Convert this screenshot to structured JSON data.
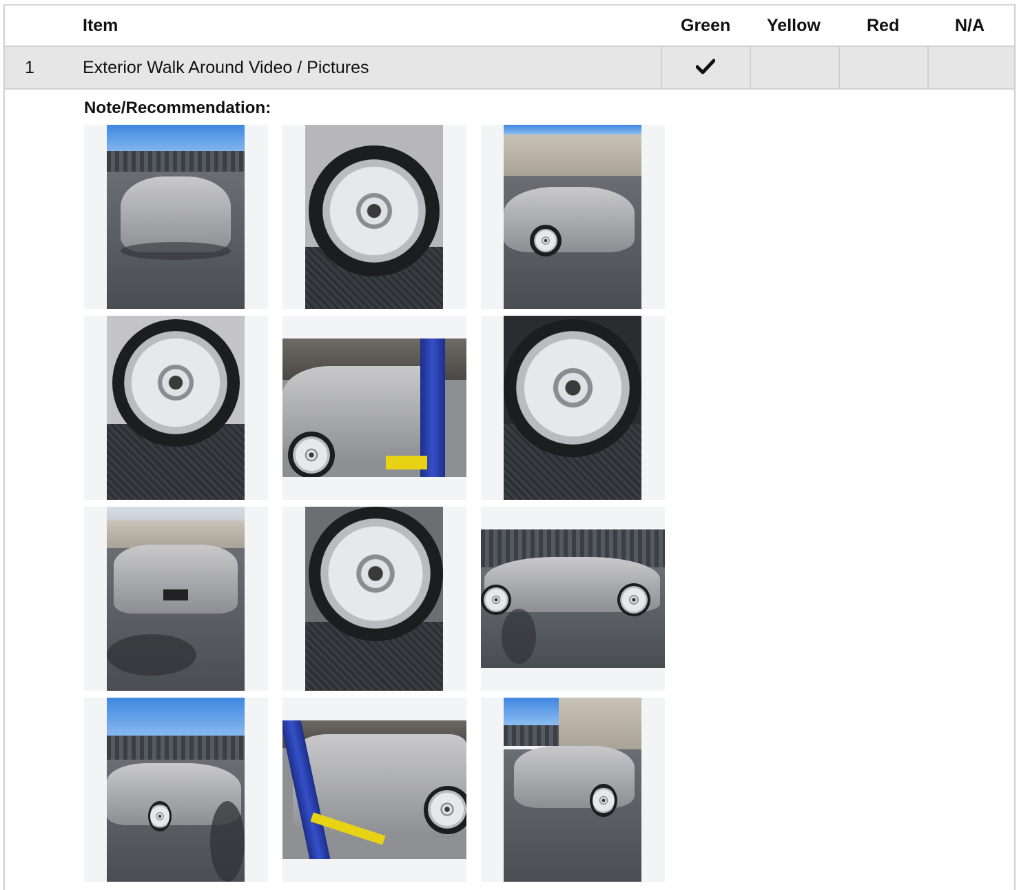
{
  "table": {
    "headers": {
      "item": "Item",
      "green": "Green",
      "yellow": "Yellow",
      "red": "Red",
      "na": "N/A"
    },
    "rows": [
      {
        "number": "1",
        "item": "Exterior Walk Around Video / Pictures",
        "status": "green",
        "check_icon": "checkmark-icon"
      }
    ]
  },
  "note": {
    "label": "Note/Recommendation:"
  },
  "photos": [
    {
      "name": "front-view-photo"
    },
    {
      "name": "wheel-closeup-photo"
    },
    {
      "name": "rear-quarter-photo"
    },
    {
      "name": "wheel-closeup-photo"
    },
    {
      "name": "side-on-lift-photo"
    },
    {
      "name": "wheel-closeup-photo"
    },
    {
      "name": "rear-view-photo"
    },
    {
      "name": "wheel-closeup-photo"
    },
    {
      "name": "side-profile-photo"
    },
    {
      "name": "front-quarter-photo"
    },
    {
      "name": "side-on-lift-photo"
    },
    {
      "name": "rear-quarter-photo"
    }
  ],
  "colors": {
    "row_background": "#e6e6e6",
    "border": "#d2d2d2",
    "tile_background": "#f3f4f6"
  }
}
